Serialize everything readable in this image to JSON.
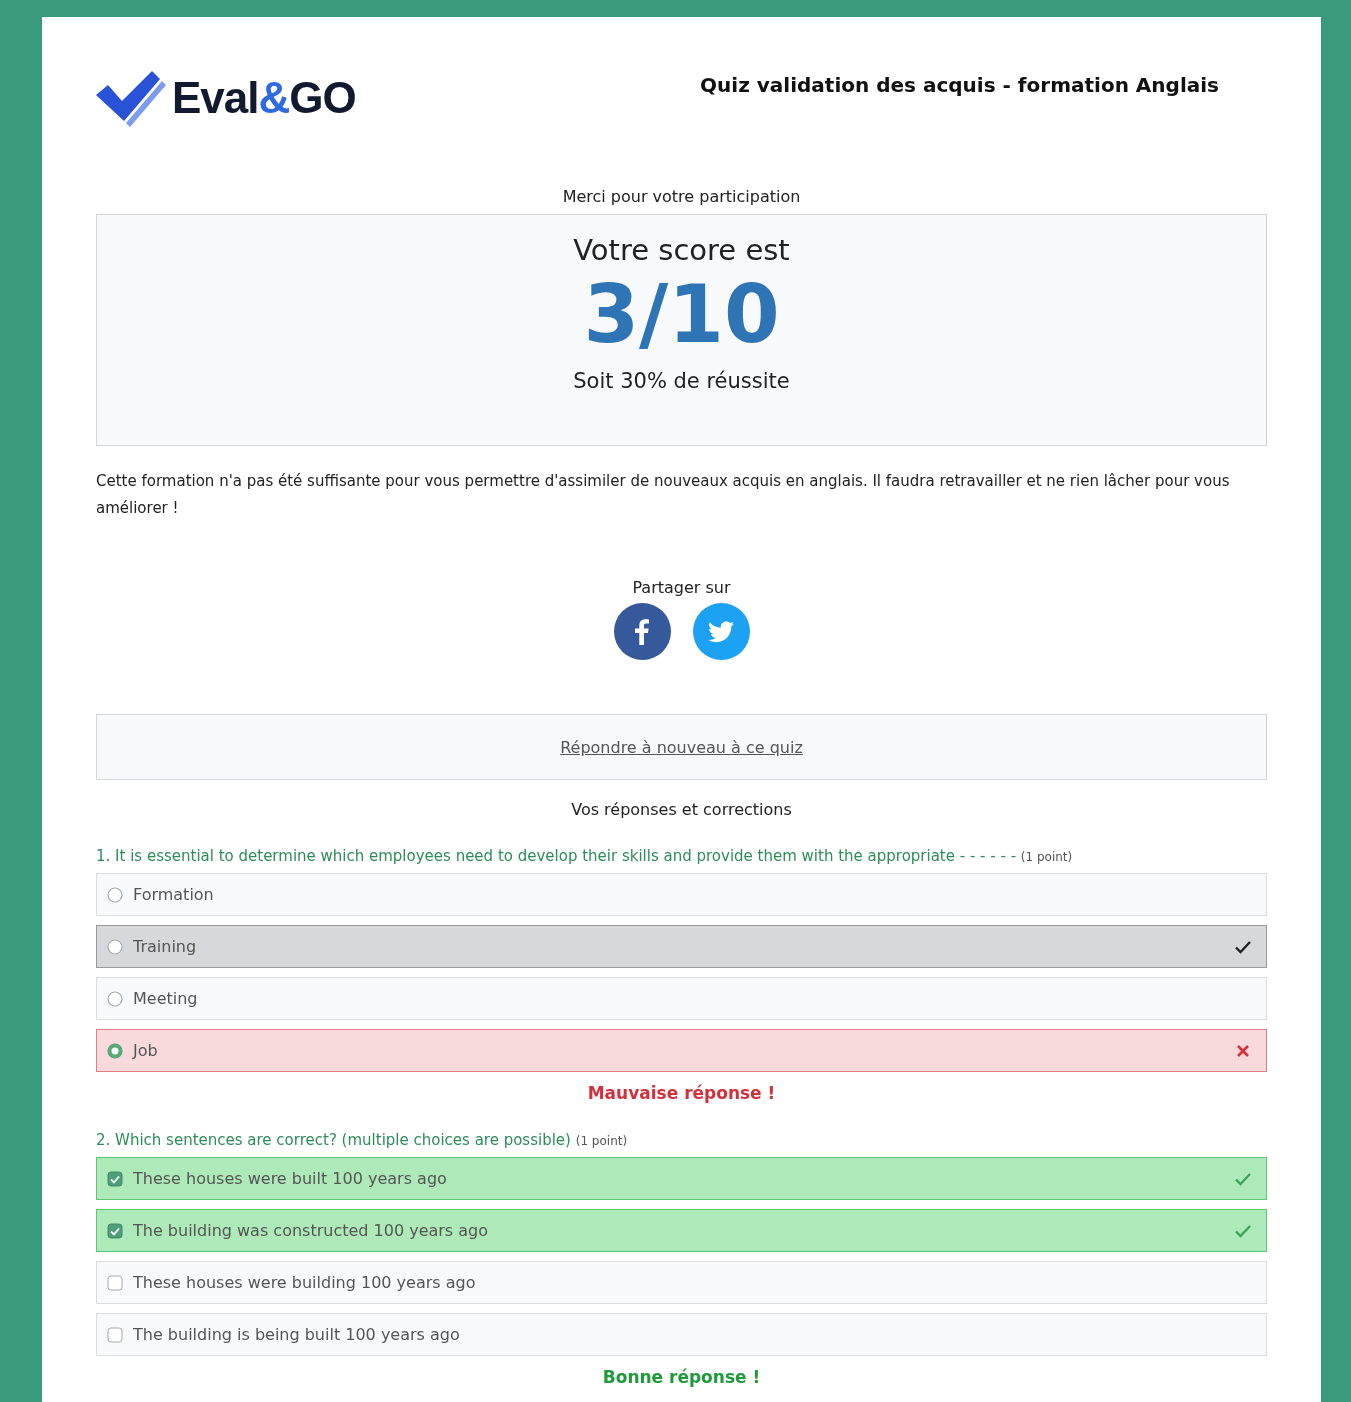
{
  "header": {
    "logo_text_1": "Eval",
    "logo_text_2": "&",
    "logo_text_3": "GO",
    "title": "Quiz validation des acquis - formation Anglais"
  },
  "thanks": "Merci pour votre participation",
  "score": {
    "heading": "Votre score est",
    "value": "3/10",
    "percent": "Soit 30% de réussite"
  },
  "message": "Cette formation n'a pas été suffisante pour vous permettre d'assimiler de nouveaux acquis en anglais. Il faudra retravailler et ne rien lâcher pour vous améliorer !",
  "share": {
    "label": "Partager sur"
  },
  "retry_link": "Répondre à nouveau à ce quiz",
  "answers_title": "Vos réponses et corrections",
  "questions": [
    {
      "kind": "radio",
      "text": "1. It is essential to determine which employees need to develop their skills and provide them with the appropriate - - - - - -",
      "points": "(1 point)",
      "options": [
        {
          "label": "Formation",
          "selected": false,
          "correct": false
        },
        {
          "label": "Training",
          "selected": false,
          "correct": true
        },
        {
          "label": "Meeting",
          "selected": false,
          "correct": false
        },
        {
          "label": "Job",
          "selected": true,
          "correct": false
        }
      ],
      "result": {
        "text": "Mauvaise réponse !",
        "correct": false
      }
    },
    {
      "kind": "checkbox",
      "text": "2. Which sentences are correct? (multiple choices are possible)",
      "points": "(1 point)",
      "options": [
        {
          "label": "These houses were built 100 years ago",
          "selected": true,
          "correct": true
        },
        {
          "label": "The building was constructed 100 years ago",
          "selected": true,
          "correct": true
        },
        {
          "label": "These houses were building 100 years ago",
          "selected": false,
          "correct": false
        },
        {
          "label": "The building is being built 100 years ago",
          "selected": false,
          "correct": false
        }
      ],
      "result": {
        "text": "Bonne réponse !",
        "correct": true
      }
    }
  ]
}
